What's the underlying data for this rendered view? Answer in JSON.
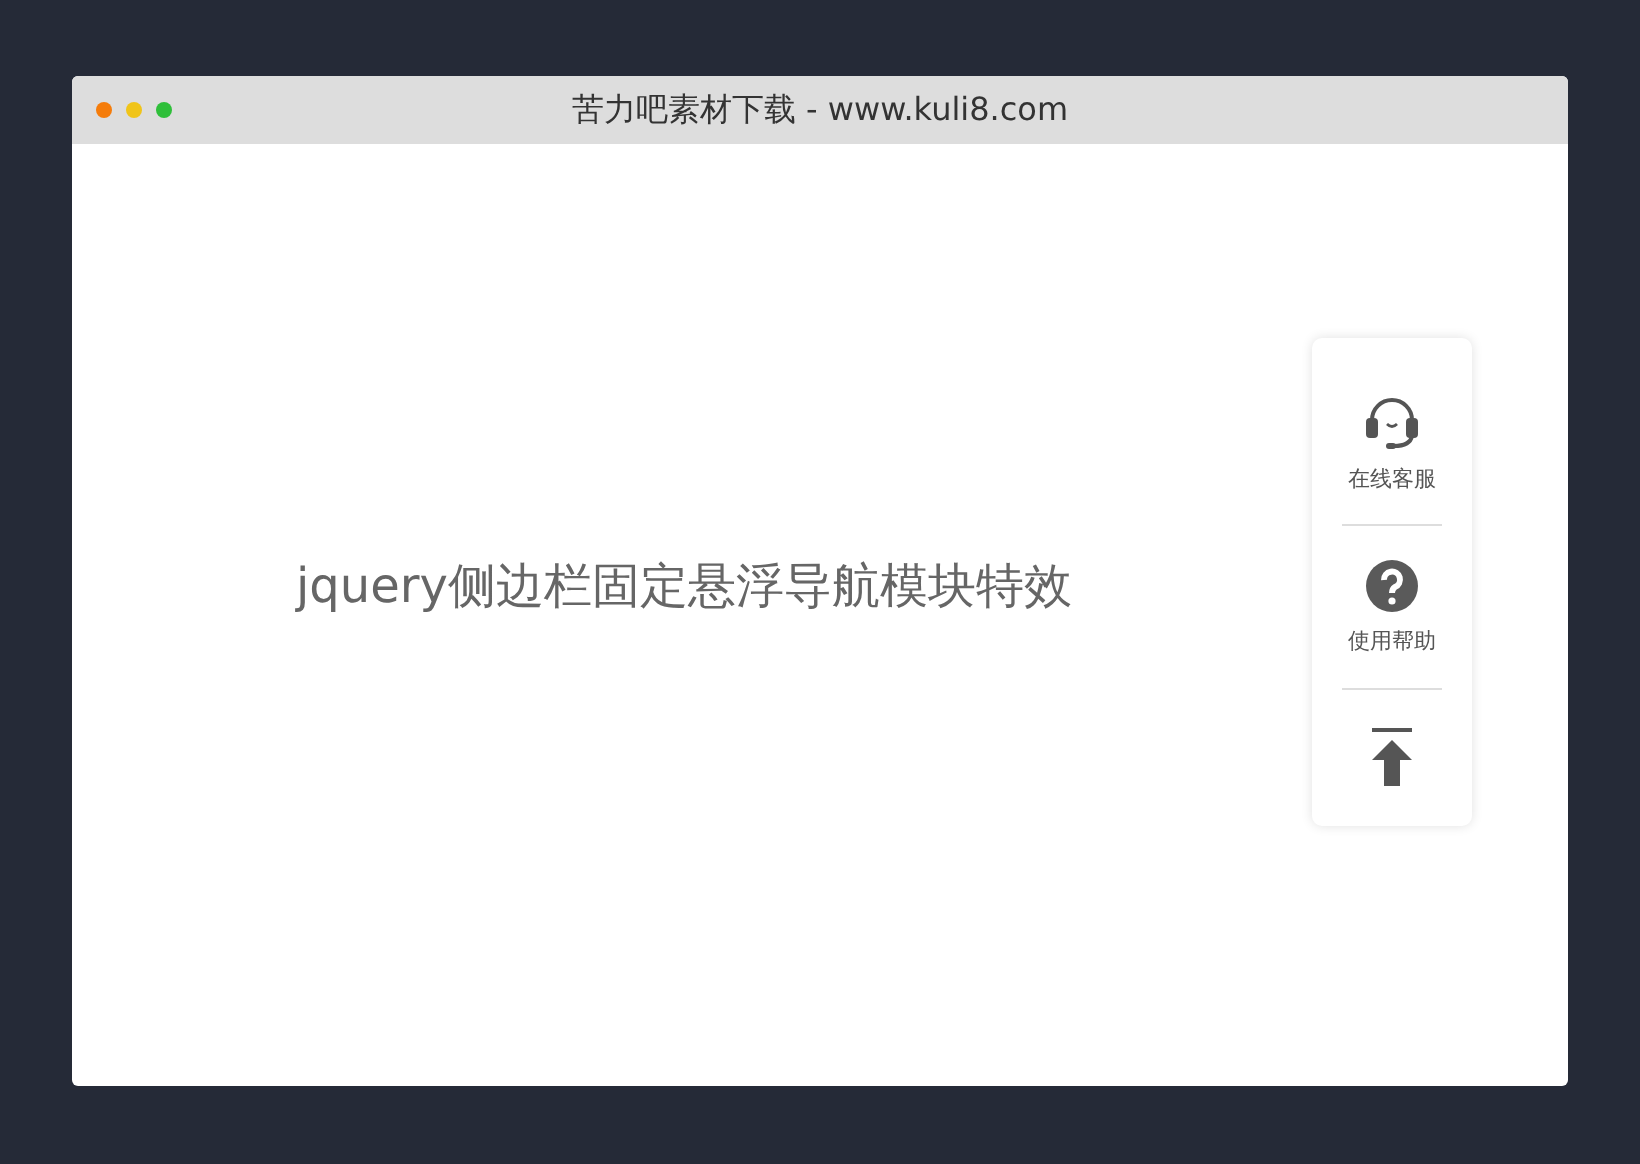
{
  "window": {
    "title": "苦力吧素材下载 - www.kuli8.com",
    "dots": [
      {
        "color": "#f57c0a"
      },
      {
        "color": "#f0c419"
      },
      {
        "color": "#2fbf3a"
      }
    ]
  },
  "heading": "jquery侧边栏固定悬浮导航模块特效",
  "sidebar": {
    "items": [
      {
        "kind": "service",
        "label": "在线客服"
      },
      {
        "kind": "help",
        "label": "使用帮助"
      },
      {
        "kind": "top"
      }
    ]
  }
}
